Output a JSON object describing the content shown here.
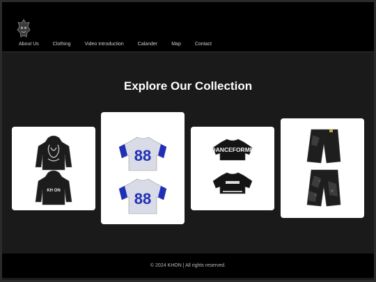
{
  "brand": {
    "logo_icon": "khon-mask-logo-icon"
  },
  "nav": {
    "items": [
      {
        "label": "About Us"
      },
      {
        "label": "Clothing"
      },
      {
        "label": "Video Introduction"
      },
      {
        "label": "Calander"
      },
      {
        "label": "Map"
      },
      {
        "label": "Contact"
      }
    ]
  },
  "main": {
    "heading": "Explore Our Collection",
    "products": [
      {
        "image": "black-hoodie-pair",
        "print": "KH ON"
      },
      {
        "image": "blue-white-football-jersey-pair",
        "number": "88"
      },
      {
        "image": "black-tshirt-pair",
        "print": "DANCEFORME"
      },
      {
        "image": "black-camo-shorts-pair"
      }
    ]
  },
  "footer": {
    "text": "© 2024 KHON | All rights reserved."
  },
  "colors": {
    "background": "#1a1a1a",
    "header": "#000000",
    "card": "#ffffff",
    "jersey_blue": "#1f2fb8"
  }
}
